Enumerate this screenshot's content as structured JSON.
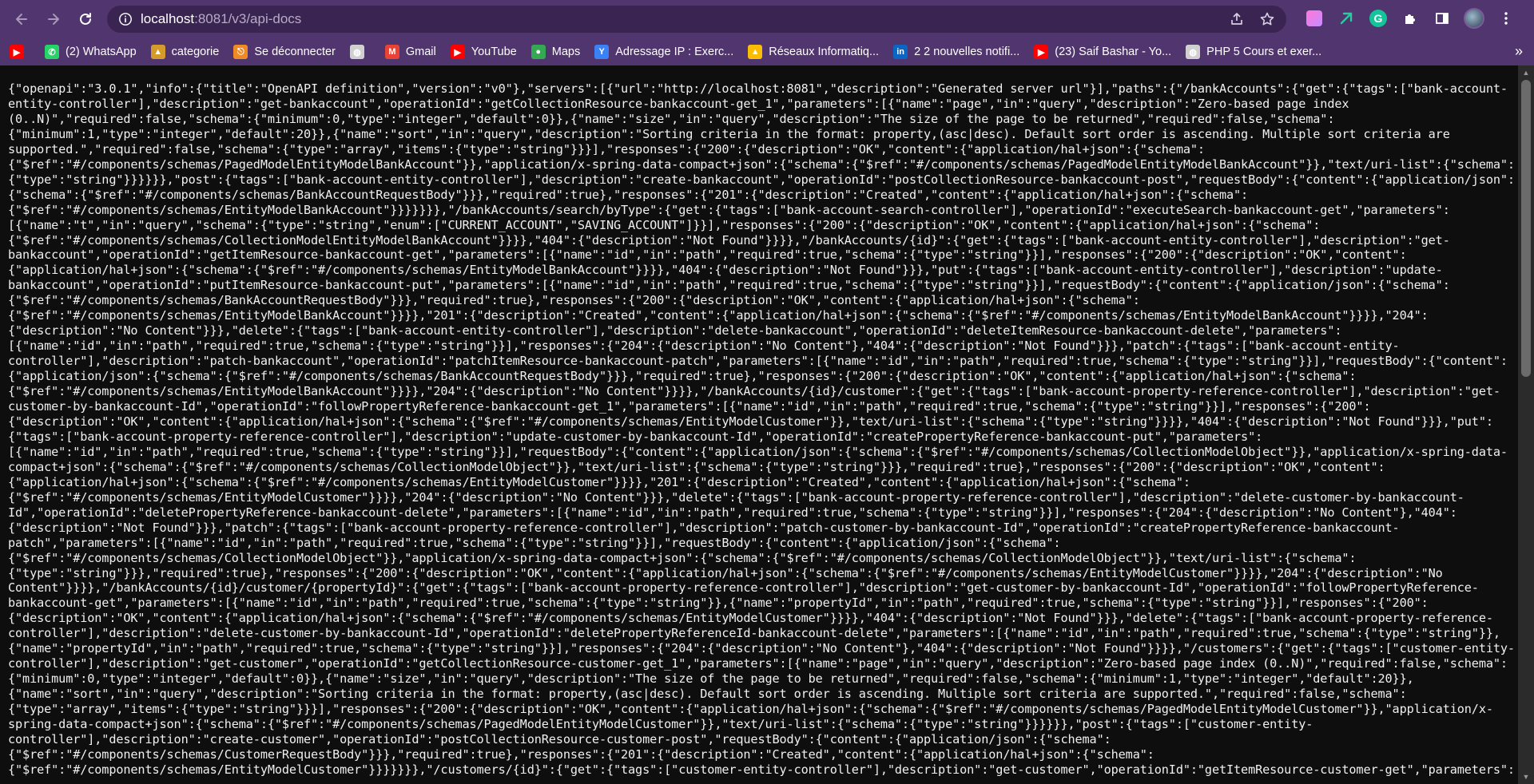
{
  "browser": {
    "url_host": "localhost",
    "url_path": ":8081/v3/api-docs",
    "colors": {
      "toolbar": "#51356e",
      "omnibox": "#3a2552",
      "page_bg": "#0e0e0e"
    }
  },
  "bookmarks": [
    {
      "label": "",
      "icon": "youtube-icon",
      "color": "#ff0000"
    },
    {
      "label": "(2) WhatsApp",
      "icon": "whatsapp-icon",
      "color": "#25d366"
    },
    {
      "label": "categorie",
      "icon": "categorie-icon",
      "color": "#d49a2a"
    },
    {
      "label": "Se déconnecter",
      "icon": "logout-icon",
      "color": "#f08a24"
    },
    {
      "label": "",
      "icon": "globe-icon",
      "color": "#d0d0d0"
    },
    {
      "label": "Gmail",
      "icon": "gmail-icon",
      "color": "#ea4335"
    },
    {
      "label": "YouTube",
      "icon": "youtube-icon",
      "color": "#ff0000"
    },
    {
      "label": "Maps",
      "icon": "maps-icon",
      "color": "#34a853"
    },
    {
      "label": "Adressage IP : Exerc...",
      "icon": "ip-icon",
      "color": "#3b82f6"
    },
    {
      "label": "Réseaux Informatiq...",
      "icon": "drive-icon",
      "color": "#fbbc04"
    },
    {
      "label": "2 2 nouvelles notifi...",
      "icon": "linkedin-icon",
      "color": "#0a66c2"
    },
    {
      "label": "(23) Saif Bashar - Yo...",
      "icon": "youtube-icon",
      "color": "#ff0000"
    },
    {
      "label": "PHP 5 Cours et exer...",
      "icon": "globe-icon",
      "color": "#d0d0d0"
    }
  ],
  "page": {
    "json_lines": [
      "{\"openapi\":\"3.0.1\",\"info\":{\"title\":\"OpenAPI definition\",\"version\":\"v0\"},\"servers\":[{\"url\":\"http://localhost:8081\",\"description\":\"Generated server url\"}],\"paths\":{\"/bankAccounts\":{\"get\":{\"tags\":[\"bank-account-",
      "entity-controller\"],\"description\":\"get-bankaccount\",\"operationId\":\"getCollectionResource-bankaccount-get_1\",\"parameters\":[{\"name\":\"page\",\"in\":\"query\",\"description\":\"Zero-based page index",
      "(0..N)\",\"required\":false,\"schema\":{\"minimum\":0,\"type\":\"integer\",\"default\":0}},{\"name\":\"size\",\"in\":\"query\",\"description\":\"The size of the page to be returned\",\"required\":false,\"schema\":",
      "{\"minimum\":1,\"type\":\"integer\",\"default\":20}},{\"name\":\"sort\",\"in\":\"query\",\"description\":\"Sorting criteria in the format: property,(asc|desc). Default sort order is ascending. Multiple sort criteria are",
      "supported.\",\"required\":false,\"schema\":{\"type\":\"array\",\"items\":{\"type\":\"string\"}}}],\"responses\":{\"200\":{\"description\":\"OK\",\"content\":{\"application/hal+json\":{\"schema\":",
      "{\"$ref\":\"#/components/schemas/PagedModelEntityModelBankAccount\"}},\"application/x-spring-data-compact+json\":{\"schema\":{\"$ref\":\"#/components/schemas/PagedModelEntityModelBankAccount\"}},\"text/uri-list\":{\"schema\":",
      "{\"type\":\"string\"}}}}}},\"post\":{\"tags\":[\"bank-account-entity-controller\"],\"description\":\"create-bankaccount\",\"operationId\":\"postCollectionResource-bankaccount-post\",\"requestBody\":{\"content\":{\"application/json\":",
      "{\"schema\":{\"$ref\":\"#/components/schemas/BankAccountRequestBody\"}}},\"required\":true},\"responses\":{\"201\":{\"description\":\"Created\",\"content\":{\"application/hal+json\":{\"schema\":",
      "{\"$ref\":\"#/components/schemas/EntityModelBankAccount\"}}}}}}},\"/bankAccounts/search/byType\":{\"get\":{\"tags\":[\"bank-account-search-controller\"],\"operationId\":\"executeSearch-bankaccount-get\",\"parameters\":",
      "[{\"name\":\"t\",\"in\":\"query\",\"schema\":{\"type\":\"string\",\"enum\":[\"CURRENT_ACCOUNT\",\"SAVING_ACCOUNT\"]}}],\"responses\":{\"200\":{\"description\":\"OK\",\"content\":{\"application/hal+json\":{\"schema\":",
      "{\"$ref\":\"#/components/schemas/CollectionModelEntityModelBankAccount\"}}}},\"404\":{\"description\":\"Not Found\"}}}},\"/bankAccounts/{id}\":{\"get\":{\"tags\":[\"bank-account-entity-controller\"],\"description\":\"get-",
      "bankaccount\",\"operationId\":\"getItemResource-bankaccount-get\",\"parameters\":[{\"name\":\"id\",\"in\":\"path\",\"required\":true,\"schema\":{\"type\":\"string\"}}],\"responses\":{\"200\":{\"description\":\"OK\",\"content\":",
      "{\"application/hal+json\":{\"schema\":{\"$ref\":\"#/components/schemas/EntityModelBankAccount\"}}}},\"404\":{\"description\":\"Not Found\"}}},\"put\":{\"tags\":[\"bank-account-entity-controller\"],\"description\":\"update-",
      "bankaccount\",\"operationId\":\"putItemResource-bankaccount-put\",\"parameters\":[{\"name\":\"id\",\"in\":\"path\",\"required\":true,\"schema\":{\"type\":\"string\"}}],\"requestBody\":{\"content\":{\"application/json\":{\"schema\":",
      "{\"$ref\":\"#/components/schemas/BankAccountRequestBody\"}}},\"required\":true},\"responses\":{\"200\":{\"description\":\"OK\",\"content\":{\"application/hal+json\":{\"schema\":",
      "{\"$ref\":\"#/components/schemas/EntityModelBankAccount\"}}}},\"201\":{\"description\":\"Created\",\"content\":{\"application/hal+json\":{\"schema\":{\"$ref\":\"#/components/schemas/EntityModelBankAccount\"}}}},\"204\":",
      "{\"description\":\"No Content\"}}},\"delete\":{\"tags\":[\"bank-account-entity-controller\"],\"description\":\"delete-bankaccount\",\"operationId\":\"deleteItemResource-bankaccount-delete\",\"parameters\":",
      "[{\"name\":\"id\",\"in\":\"path\",\"required\":true,\"schema\":{\"type\":\"string\"}}],\"responses\":{\"204\":{\"description\":\"No Content\"},\"404\":{\"description\":\"Not Found\"}}},\"patch\":{\"tags\":[\"bank-account-entity-",
      "controller\"],\"description\":\"patch-bankaccount\",\"operationId\":\"patchItemResource-bankaccount-patch\",\"parameters\":[{\"name\":\"id\",\"in\":\"path\",\"required\":true,\"schema\":{\"type\":\"string\"}}],\"requestBody\":{\"content\":",
      "{\"application/json\":{\"schema\":{\"$ref\":\"#/components/schemas/BankAccountRequestBody\"}}},\"required\":true},\"responses\":{\"200\":{\"description\":\"OK\",\"content\":{\"application/hal+json\":{\"schema\":",
      "{\"$ref\":\"#/components/schemas/EntityModelBankAccount\"}}}},\"204\":{\"description\":\"No Content\"}}}},\"/bankAccounts/{id}/customer\":{\"get\":{\"tags\":[\"bank-account-property-reference-controller\"],\"description\":\"get-",
      "customer-by-bankaccount-Id\",\"operationId\":\"followPropertyReference-bankaccount-get_1\",\"parameters\":[{\"name\":\"id\",\"in\":\"path\",\"required\":true,\"schema\":{\"type\":\"string\"}}],\"responses\":{\"200\":",
      "{\"description\":\"OK\",\"content\":{\"application/hal+json\":{\"schema\":{\"$ref\":\"#/components/schemas/EntityModelCustomer\"}},\"text/uri-list\":{\"schema\":{\"type\":\"string\"}}}},\"404\":{\"description\":\"Not Found\"}}},\"put\":",
      "{\"tags\":[\"bank-account-property-reference-controller\"],\"description\":\"update-customer-by-bankaccount-Id\",\"operationId\":\"createPropertyReference-bankaccount-put\",\"parameters\":",
      "[{\"name\":\"id\",\"in\":\"path\",\"required\":true,\"schema\":{\"type\":\"string\"}}],\"requestBody\":{\"content\":{\"application/json\":{\"schema\":{\"$ref\":\"#/components/schemas/CollectionModelObject\"}},\"application/x-spring-data-",
      "compact+json\":{\"schema\":{\"$ref\":\"#/components/schemas/CollectionModelObject\"}},\"text/uri-list\":{\"schema\":{\"type\":\"string\"}}},\"required\":true},\"responses\":{\"200\":{\"description\":\"OK\",\"content\":",
      "{\"application/hal+json\":{\"schema\":{\"$ref\":\"#/components/schemas/EntityModelCustomer\"}}}},\"201\":{\"description\":\"Created\",\"content\":{\"application/hal+json\":{\"schema\":",
      "{\"$ref\":\"#/components/schemas/EntityModelCustomer\"}}}},\"204\":{\"description\":\"No Content\"}}},\"delete\":{\"tags\":[\"bank-account-property-reference-controller\"],\"description\":\"delete-customer-by-bankaccount-",
      "Id\",\"operationId\":\"deletePropertyReference-bankaccount-delete\",\"parameters\":[{\"name\":\"id\",\"in\":\"path\",\"required\":true,\"schema\":{\"type\":\"string\"}}],\"responses\":{\"204\":{\"description\":\"No Content\"},\"404\":",
      "{\"description\":\"Not Found\"}}},\"patch\":{\"tags\":[\"bank-account-property-reference-controller\"],\"description\":\"patch-customer-by-bankaccount-Id\",\"operationId\":\"createPropertyReference-bankaccount-",
      "patch\",\"parameters\":[{\"name\":\"id\",\"in\":\"path\",\"required\":true,\"schema\":{\"type\":\"string\"}}],\"requestBody\":{\"content\":{\"application/json\":{\"schema\":",
      "{\"$ref\":\"#/components/schemas/CollectionModelObject\"}},\"application/x-spring-data-compact+json\":{\"schema\":{\"$ref\":\"#/components/schemas/CollectionModelObject\"}},\"text/uri-list\":{\"schema\":",
      "{\"type\":\"string\"}}},\"required\":true},\"responses\":{\"200\":{\"description\":\"OK\",\"content\":{\"application/hal+json\":{\"schema\":{\"$ref\":\"#/components/schemas/EntityModelCustomer\"}}}},\"204\":{\"description\":\"No",
      "Content\"}}}},\"/bankAccounts/{id}/customer/{propertyId}\":{\"get\":{\"tags\":[\"bank-account-property-reference-controller\"],\"description\":\"get-customer-by-bankaccount-Id\",\"operationId\":\"followPropertyReference-",
      "bankaccount-get\",\"parameters\":[{\"name\":\"id\",\"in\":\"path\",\"required\":true,\"schema\":{\"type\":\"string\"}},{\"name\":\"propertyId\",\"in\":\"path\",\"required\":true,\"schema\":{\"type\":\"string\"}}],\"responses\":{\"200\":",
      "{\"description\":\"OK\",\"content\":{\"application/hal+json\":{\"schema\":{\"$ref\":\"#/components/schemas/EntityModelCustomer\"}}}},\"404\":{\"description\":\"Not Found\"}}},\"delete\":{\"tags\":[\"bank-account-property-reference-",
      "controller\"],\"description\":\"delete-customer-by-bankaccount-Id\",\"operationId\":\"deletePropertyReferenceId-bankaccount-delete\",\"parameters\":[{\"name\":\"id\",\"in\":\"path\",\"required\":true,\"schema\":{\"type\":\"string\"}},",
      "{\"name\":\"propertyId\",\"in\":\"path\",\"required\":true,\"schema\":{\"type\":\"string\"}}],\"responses\":{\"204\":{\"description\":\"No Content\"},\"404\":{\"description\":\"Not Found\"}}}},\"/customers\":{\"get\":{\"tags\":[\"customer-entity-",
      "controller\"],\"description\":\"get-customer\",\"operationId\":\"getCollectionResource-customer-get_1\",\"parameters\":[{\"name\":\"page\",\"in\":\"query\",\"description\":\"Zero-based page index (0..N)\",\"required\":false,\"schema\":",
      "{\"minimum\":0,\"type\":\"integer\",\"default\":0}},{\"name\":\"size\",\"in\":\"query\",\"description\":\"The size of the page to be returned\",\"required\":false,\"schema\":{\"minimum\":1,\"type\":\"integer\",\"default\":20}},",
      "{\"name\":\"sort\",\"in\":\"query\",\"description\":\"Sorting criteria in the format: property,(asc|desc). Default sort order is ascending. Multiple sort criteria are supported.\",\"required\":false,\"schema\":",
      "{\"type\":\"array\",\"items\":{\"type\":\"string\"}}}],\"responses\":{\"200\":{\"description\":\"OK\",\"content\":{\"application/hal+json\":{\"schema\":{\"$ref\":\"#/components/schemas/PagedModelEntityModelCustomer\"}},\"application/x-",
      "spring-data-compact+json\":{\"schema\":{\"$ref\":\"#/components/schemas/PagedModelEntityModelCustomer\"}},\"text/uri-list\":{\"schema\":{\"type\":\"string\"}}}}}},\"post\":{\"tags\":[\"customer-entity-",
      "controller\"],\"description\":\"create-customer\",\"operationId\":\"postCollectionResource-customer-post\",\"requestBody\":{\"content\":{\"application/json\":{\"schema\":",
      "{\"$ref\":\"#/components/schemas/CustomerRequestBody\"}}},\"required\":true},\"responses\":{\"201\":{\"description\":\"Created\",\"content\":{\"application/hal+json\":{\"schema\":",
      "{\"$ref\":\"#/components/schemas/EntityModelCustomer\"}}}}}}},\"/customers/{id}\":{\"get\":{\"tags\":[\"customer-entity-controller\"],\"description\":\"get-customer\",\"operationId\":\"getItemResource-customer-get\",\"parameters\":"
    ]
  }
}
